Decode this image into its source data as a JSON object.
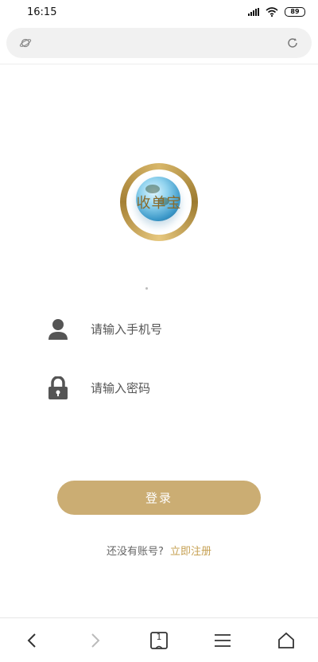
{
  "status_bar": {
    "time": "16:15",
    "battery": "89"
  },
  "logo": {
    "text": "收单宝"
  },
  "form": {
    "phone_placeholder": "请输入手机号",
    "password_placeholder": "请输入密码",
    "login_label": "登录"
  },
  "register": {
    "prompt": "还没有账号?",
    "link": "立即注册"
  },
  "bottom_nav": {
    "tabs_count": "1"
  },
  "colors": {
    "accent": "#cbad73",
    "link": "#c6a052"
  }
}
